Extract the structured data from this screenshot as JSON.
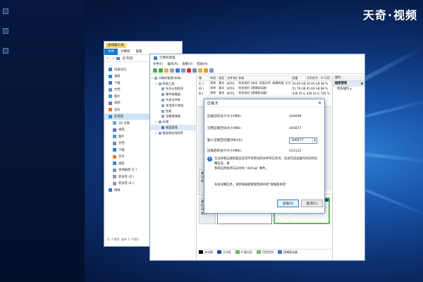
{
  "watermark": {
    "brand": "天奇",
    "sep": "·",
    "sub": "视频"
  },
  "explorer": {
    "tab_manage": "驱动器工具",
    "ribbon": {
      "file": "文件",
      "computer": "计算机",
      "view": "查看"
    },
    "address": "此电脑",
    "nav_items": [
      {
        "label": "快速访问",
        "icon": "star-icon"
      },
      {
        "label": "桌面",
        "icon": "desktop-icon"
      },
      {
        "label": "下载",
        "icon": "download-icon"
      },
      {
        "label": "文档",
        "icon": "document-icon"
      },
      {
        "label": "图片",
        "icon": "picture-icon"
      },
      {
        "label": "视频",
        "icon": "video-icon"
      },
      {
        "label": "音乐",
        "icon": "music-icon"
      },
      {
        "label": "此电脑",
        "icon": "computer-icon",
        "selected": true
      },
      {
        "label": "3D 对象",
        "icon": "cube-icon"
      },
      {
        "label": "视频",
        "icon": "video-icon"
      },
      {
        "label": "图片",
        "icon": "picture-icon"
      },
      {
        "label": "文档",
        "icon": "document-icon"
      },
      {
        "label": "下载",
        "icon": "download-icon"
      },
      {
        "label": "音乐",
        "icon": "music-icon"
      },
      {
        "label": "桌面",
        "icon": "desktop-icon"
      },
      {
        "label": "本地磁盘 (C:)",
        "icon": "drive-icon"
      },
      {
        "label": "新加卷 (D:)",
        "icon": "drive-icon"
      },
      {
        "label": "新加卷 (E:)",
        "icon": "drive-icon"
      },
      {
        "label": "网络",
        "icon": "network-icon"
      }
    ],
    "status": "11 个项目",
    "status2": "选中 1 个项目"
  },
  "cm": {
    "title": "计算机管理",
    "menu": [
      "文件(F)",
      "操作(A)",
      "查看(V)",
      "帮助(H)"
    ],
    "tree": [
      {
        "label": "计算机管理(本地)",
        "level": 0
      },
      {
        "label": "系统工具",
        "level": 1
      },
      {
        "label": "任务计划程序",
        "level": 2
      },
      {
        "label": "事件查看器",
        "level": 2
      },
      {
        "label": "共享文件夹",
        "level": 2
      },
      {
        "label": "本地用户和组",
        "level": 2
      },
      {
        "label": "性能",
        "level": 2
      },
      {
        "label": "设备管理器",
        "level": 2
      },
      {
        "label": "存储",
        "level": 1
      },
      {
        "label": "磁盘管理",
        "level": 2,
        "selected": true
      },
      {
        "label": "服务和应用程序",
        "level": 1
      }
    ],
    "table": {
      "headers": [
        "卷",
        "布局",
        "类型",
        "文件系统",
        "状态",
        "容量",
        "可用空间",
        "% 可用"
      ],
      "rows": [
        [
          "(C:)",
          "简单",
          "基本",
          "NTFS",
          "状态良好 (启动, 页面文件, 故障转储, 主分区)",
          "50.00 GB",
          "24.04 GB",
          "48 %"
        ],
        [
          "(D:)",
          "简单",
          "基本",
          "NTFS",
          "状态良好 (逻辑驱动器)",
          "51.79 GB",
          "45.69 GB",
          "88 %"
        ],
        [
          "(E:)",
          "简单",
          "基本",
          "NTFS",
          "状态良好 (逻辑驱动器)",
          "439.45 GB",
          "439.24 GB",
          "100 %"
        ]
      ]
    },
    "disk1": {
      "name": "基本",
      "size": "111.",
      "state": "联机"
    },
    "disk2": {
      "name": "基本",
      "size": "931.51 GB",
      "state": "联机"
    },
    "part_a": {
      "size": "492.06 GB NTFS",
      "state": "状态良好 (逻辑驱动器)"
    },
    "part_b": {
      "size": "439.45 GB NTFS",
      "state": "状态良好 (逻辑驱动器)"
    },
    "legend": [
      {
        "label": "未分配",
        "color": "#000000"
      },
      {
        "label": "主分区",
        "color": "#1c4aa6"
      },
      {
        "label": "扩展分区",
        "color": "#5fbc55"
      },
      {
        "label": "可用空间",
        "color": "#6ac35c"
      },
      {
        "label": "逻辑驱动器",
        "color": "#2f78d0"
      }
    ],
    "actions": {
      "header": "操作",
      "section": "磁盘管理",
      "more": "更多操作"
    }
  },
  "dialog": {
    "title": "压缩 E:",
    "rows": [
      {
        "label": "压缩前的总计大小(MB):",
        "value": "449999"
      },
      {
        "label": "可用压缩空间大小(MB):",
        "value": "446877"
      },
      {
        "label": "输入压缩空间量(MB)(E):",
        "value": "306877"
      },
      {
        "label": "压缩后的总计大小(MB):",
        "value": "143122"
      }
    ],
    "info_line1": "无法将卷压缩到超出任何不可移动的文件所在的点。有关完成该操作时间的详细信息，请",
    "info_line2": "参阅应用程序日志中的 \"defrag\" 事件。",
    "more_info": "有关详细信息，请参阅磁盘管理帮助中的\"收缩基本卷\"",
    "btn_ok": "压缩(S)",
    "btn_cancel": "取消(C)"
  }
}
